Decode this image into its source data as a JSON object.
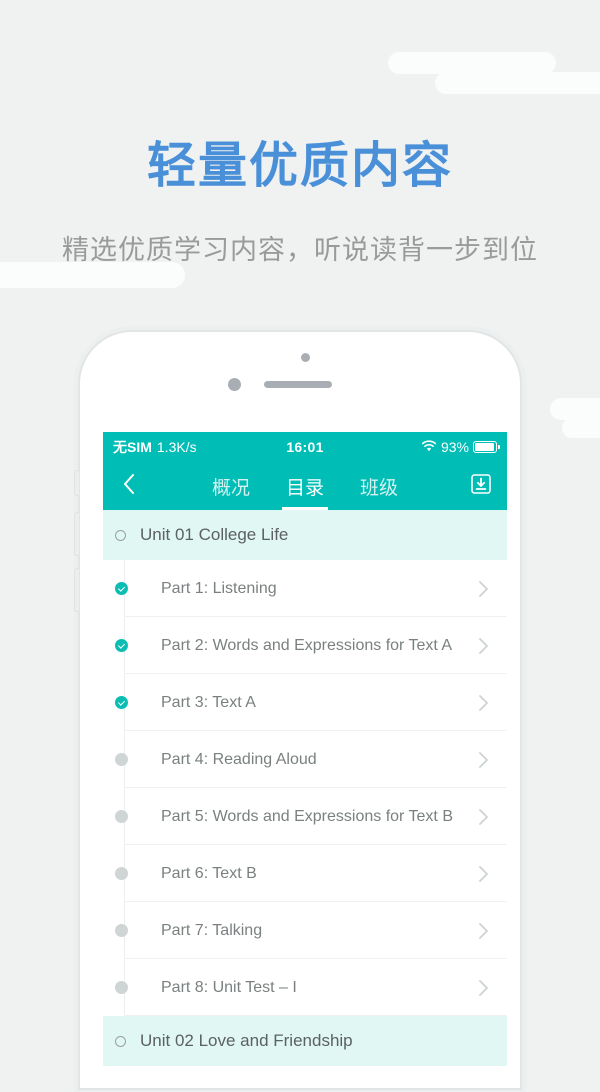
{
  "hero": {
    "headline": "轻量优质内容",
    "subhead": "精选优质学习内容，听说读背一步到位",
    "headline_color": "#4a90d9",
    "subhead_color": "#9a9a9a",
    "background_color": "#f0f2f1"
  },
  "phone": {
    "accent_color": "#00bdb6",
    "unit_row_bg": "#e0f7f4",
    "done_color": "#0cbdb3",
    "todo_color": "#cfd4d4"
  },
  "statusbar": {
    "carrier": "无SIM",
    "network_speed": "1.3K/s",
    "time": "16:01",
    "battery_percent": "93%",
    "wifi_icon": "wifi-icon",
    "battery_icon": "battery-icon"
  },
  "navbar": {
    "back_icon": "chevron-left-icon",
    "download_icon": "download-icon",
    "tabs": [
      {
        "label": "概况",
        "active": false
      },
      {
        "label": "目录",
        "active": true
      },
      {
        "label": "班级",
        "active": false
      }
    ]
  },
  "catalog": {
    "units": [
      {
        "title": "Unit 01 College Life",
        "parts": [
          {
            "title": "Part 1: Listening",
            "completed": true
          },
          {
            "title": "Part 2: Words and Expressions for Text A",
            "completed": true
          },
          {
            "title": "Part 3: Text A",
            "completed": true
          },
          {
            "title": "Part 4: Reading Aloud",
            "completed": false
          },
          {
            "title": "Part 5: Words and Expressions for Text B",
            "completed": false
          },
          {
            "title": "Part 6: Text B",
            "completed": false
          },
          {
            "title": "Part 7: Talking",
            "completed": false
          },
          {
            "title": "Part 8: Unit Test – I",
            "completed": false
          }
        ]
      },
      {
        "title": "Unit 02 Love and Friendship",
        "parts": []
      }
    ]
  }
}
